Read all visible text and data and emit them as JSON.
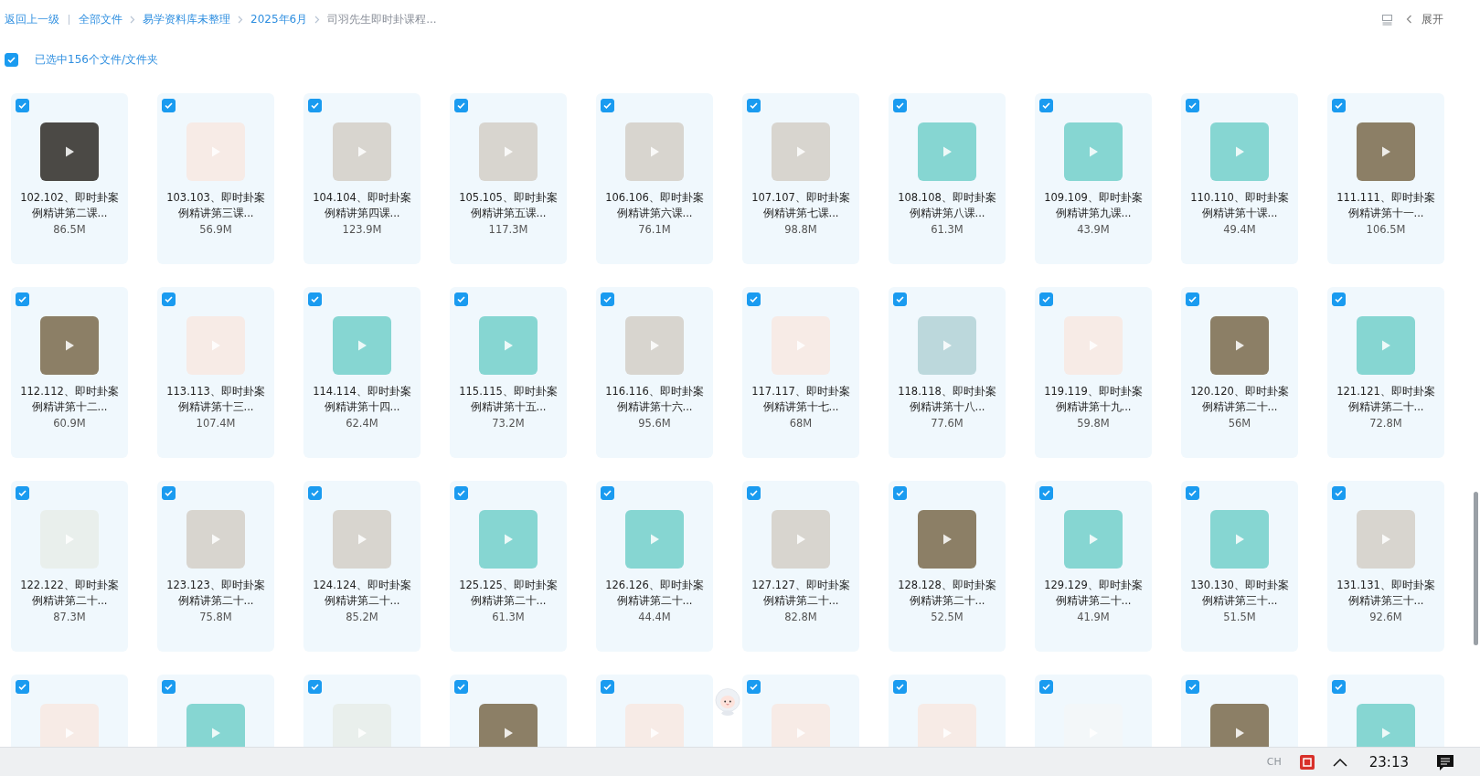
{
  "breadcrumb": {
    "back": "返回上一级",
    "items": [
      {
        "label": "全部文件",
        "current": false
      },
      {
        "label": "易学资料库未整理",
        "current": false
      },
      {
        "label": "2025年6月",
        "current": false
      },
      {
        "label": "司羽先生即时卦课程...",
        "current": true
      }
    ]
  },
  "toolbar": {
    "expand": "展开"
  },
  "selection": {
    "checked": true,
    "label": "已选中156个文件/文件夹"
  },
  "files": [
    {
      "kind": "photo",
      "name": "102.102、即时卦案例精讲第二课...",
      "size": "86.5M",
      "checked": true
    },
    {
      "kind": "poster",
      "name": "103.103、即时卦案例精讲第三课...",
      "size": "56.9M",
      "checked": true
    },
    {
      "kind": "paper",
      "name": "104.104、即时卦案例精讲第四课...",
      "size": "123.9M",
      "checked": true
    },
    {
      "kind": "paper",
      "name": "105.105、即时卦案例精讲第五课...",
      "size": "117.3M",
      "checked": true
    },
    {
      "kind": "paper",
      "name": "106.106、即时卦案例精讲第六课...",
      "size": "76.1M",
      "checked": true
    },
    {
      "kind": "paper",
      "name": "107.107、即时卦案例精讲第七课...",
      "size": "98.8M",
      "checked": true
    },
    {
      "kind": "teal",
      "name": "108.108、即时卦案例精讲第八课...",
      "size": "61.3M",
      "checked": true
    },
    {
      "kind": "teal",
      "name": "109.109、即时卦案例精讲第九课...",
      "size": "43.9M",
      "checked": true
    },
    {
      "kind": "teal",
      "name": "110.110、即时卦案例精讲第十课...",
      "size": "49.4M",
      "checked": true
    },
    {
      "kind": "collage",
      "name": "111.111、即时卦案例精讲第十一...",
      "size": "106.5M",
      "checked": true
    },
    {
      "kind": "collage",
      "name": "112.112、即时卦案例精讲第十二...",
      "size": "60.9M",
      "checked": true
    },
    {
      "kind": "poster",
      "name": "113.113、即时卦案例精讲第十三...",
      "size": "107.4M",
      "checked": true
    },
    {
      "kind": "teal",
      "name": "114.114、即时卦案例精讲第十四...",
      "size": "62.4M",
      "checked": true
    },
    {
      "kind": "teal",
      "name": "115.115、即时卦案例精讲第十五...",
      "size": "73.2M",
      "checked": true
    },
    {
      "kind": "paper",
      "name": "116.116、即时卦案例精讲第十六...",
      "size": "95.6M",
      "checked": true
    },
    {
      "kind": "poster",
      "name": "117.117、即时卦案例精讲第十七...",
      "size": "68M",
      "checked": true
    },
    {
      "kind": "landscape",
      "name": "118.118、即时卦案例精讲第十八...",
      "size": "77.6M",
      "checked": true
    },
    {
      "kind": "poster",
      "name": "119.119、即时卦案例精讲第十九...",
      "size": "59.8M",
      "checked": true
    },
    {
      "kind": "collage",
      "name": "120.120、即时卦案例精讲第二十...",
      "size": "56M",
      "checked": true
    },
    {
      "kind": "teal",
      "name": "121.121、即时卦案例精讲第二十...",
      "size": "72.8M",
      "checked": true
    },
    {
      "kind": "screen",
      "name": "122.122、即时卦案例精讲第二十...",
      "size": "87.3M",
      "checked": true
    },
    {
      "kind": "paper",
      "name": "123.123、即时卦案例精讲第二十...",
      "size": "75.8M",
      "checked": true
    },
    {
      "kind": "paper",
      "name": "124.124、即时卦案例精讲第二十...",
      "size": "85.2M",
      "checked": true
    },
    {
      "kind": "teal",
      "name": "125.125、即时卦案例精讲第二十...",
      "size": "61.3M",
      "checked": true
    },
    {
      "kind": "teal",
      "name": "126.126、即时卦案例精讲第二十...",
      "size": "44.4M",
      "checked": true
    },
    {
      "kind": "paper",
      "name": "127.127、即时卦案例精讲第二十...",
      "size": "82.8M",
      "checked": true
    },
    {
      "kind": "collage",
      "name": "128.128、即时卦案例精讲第二十...",
      "size": "52.5M",
      "checked": true
    },
    {
      "kind": "teal",
      "name": "129.129、即时卦案例精讲第二十...",
      "size": "41.9M",
      "checked": true
    },
    {
      "kind": "teal",
      "name": "130.130、即时卦案例精讲第三十...",
      "size": "51.5M",
      "checked": true
    },
    {
      "kind": "paper",
      "name": "131.131、即时卦案例精讲第三十...",
      "size": "92.6M",
      "checked": true
    },
    {
      "kind": "poster",
      "checked": true
    },
    {
      "kind": "teal",
      "checked": true
    },
    {
      "kind": "screen",
      "checked": true
    },
    {
      "kind": "collage",
      "checked": true
    },
    {
      "kind": "poster",
      "checked": true
    },
    {
      "kind": "poster",
      "checked": true
    },
    {
      "kind": "poster",
      "checked": true
    },
    {
      "kind": "blank",
      "checked": true
    },
    {
      "kind": "collage",
      "checked": true
    },
    {
      "kind": "teal",
      "checked": true
    }
  ],
  "taskbar": {
    "input_method": "CH",
    "time": "23:13"
  }
}
